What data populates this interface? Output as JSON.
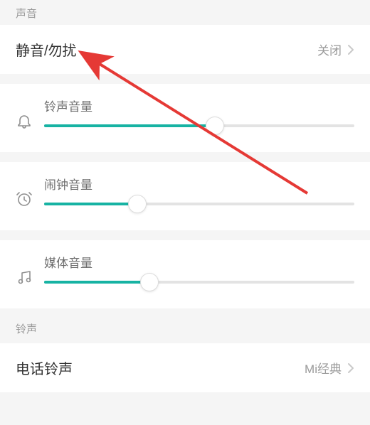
{
  "header": {
    "title": "声音"
  },
  "dnd": {
    "label": "静音/勿扰",
    "value": "关闭"
  },
  "sliders": {
    "ring": {
      "label": "铃声音量",
      "percent": 55
    },
    "alarm": {
      "label": "闹钟音量",
      "percent": 30
    },
    "media": {
      "label": "媒体音量",
      "percent": 34
    }
  },
  "ringtone_section": {
    "header": "铃声"
  },
  "phone_ringtone": {
    "label": "电话铃声",
    "value": "Mi经典"
  }
}
